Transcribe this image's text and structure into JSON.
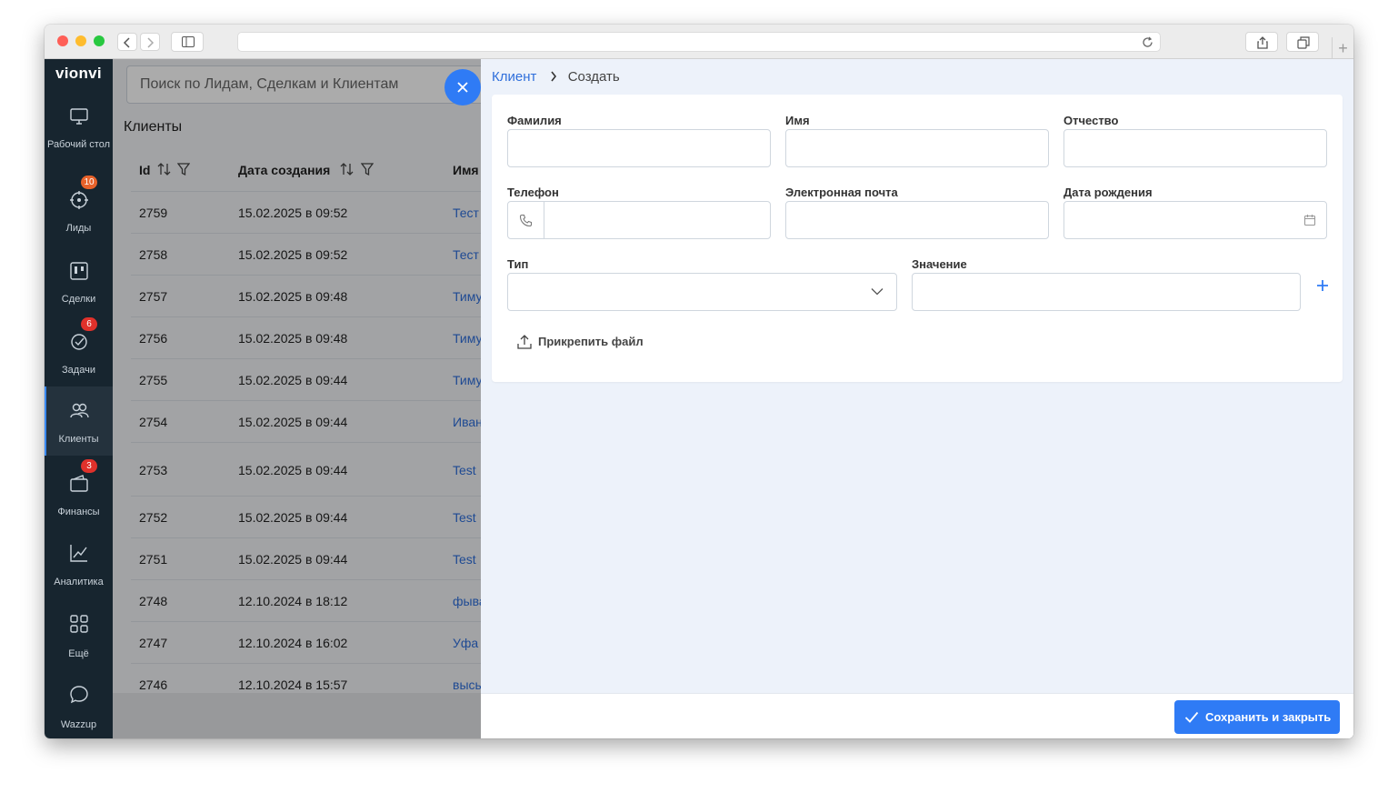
{
  "sidebar": {
    "brand": "vionvi",
    "items": [
      {
        "label": "Рабочий стол",
        "icon": "monitor-icon",
        "badge": ""
      },
      {
        "label": "Лиды",
        "icon": "target-icon",
        "badge": "10"
      },
      {
        "label": "Сделки",
        "icon": "kanban-icon",
        "badge": ""
      },
      {
        "label": "Задачи",
        "icon": "check-circle-icon",
        "badge": "6"
      },
      {
        "label": "Клиенты",
        "icon": "users-icon",
        "badge": ""
      },
      {
        "label": "Финансы",
        "icon": "wallet-icon",
        "badge": "3"
      },
      {
        "label": "Аналитика",
        "icon": "chart-icon",
        "badge": ""
      },
      {
        "label": "Ещё",
        "icon": "grid-icon",
        "badge": ""
      },
      {
        "label": "Wazzup",
        "icon": "chat-icon",
        "badge": ""
      }
    ]
  },
  "search": {
    "placeholder": "Поиск по Лидам, Сделкам и Клиентам"
  },
  "page": {
    "title": "Клиенты"
  },
  "table": {
    "headers": {
      "id": "Id",
      "date": "Дата создания",
      "name": "Имя"
    },
    "rows": [
      {
        "id": "2759",
        "date": "15.02.2025 в 09:52",
        "name": "Тест"
      },
      {
        "id": "2758",
        "date": "15.02.2025 в 09:52",
        "name": "Тест"
      },
      {
        "id": "2757",
        "date": "15.02.2025 в 09:48",
        "name": "Тиму"
      },
      {
        "id": "2756",
        "date": "15.02.2025 в 09:48",
        "name": "Тиму"
      },
      {
        "id": "2755",
        "date": "15.02.2025 в 09:44",
        "name": "Тиму"
      },
      {
        "id": "2754",
        "date": "15.02.2025 в 09:44",
        "name": "Иван"
      },
      {
        "id": "2753",
        "date": "15.02.2025 в 09:44",
        "name": "Test"
      },
      {
        "id": "2752",
        "date": "15.02.2025 в 09:44",
        "name": "Test"
      },
      {
        "id": "2751",
        "date": "15.02.2025 в 09:44",
        "name": "Test"
      },
      {
        "id": "2748",
        "date": "12.10.2024 в 18:12",
        "name": "фыва"
      },
      {
        "id": "2747",
        "date": "12.10.2024 в 16:02",
        "name": "Уфа"
      },
      {
        "id": "2746",
        "date": "12.10.2024 в 15:57",
        "name": "высь"
      }
    ]
  },
  "drawer": {
    "breadcrumb": {
      "parent": "Клиент",
      "current": "Создать"
    },
    "fields": {
      "last_name": {
        "label": "Фамилия",
        "value": ""
      },
      "first_name": {
        "label": "Имя",
        "value": ""
      },
      "patronymic": {
        "label": "Отчество",
        "value": ""
      },
      "phone": {
        "label": "Телефон",
        "value": ""
      },
      "email": {
        "label": "Электронная почта",
        "value": ""
      },
      "birth_date": {
        "label": "Дата рождения",
        "value": ""
      },
      "type": {
        "label": "Тип",
        "value": ""
      },
      "value": {
        "label": "Значение",
        "value": ""
      }
    },
    "attach_label": "Прикрепить файл",
    "save_label": "Сохранить и закрыть"
  },
  "colors": {
    "accent": "#2f7bf5",
    "sidebar": "#17252f",
    "badge": "#e0312b",
    "link": "#2f6fdb"
  }
}
